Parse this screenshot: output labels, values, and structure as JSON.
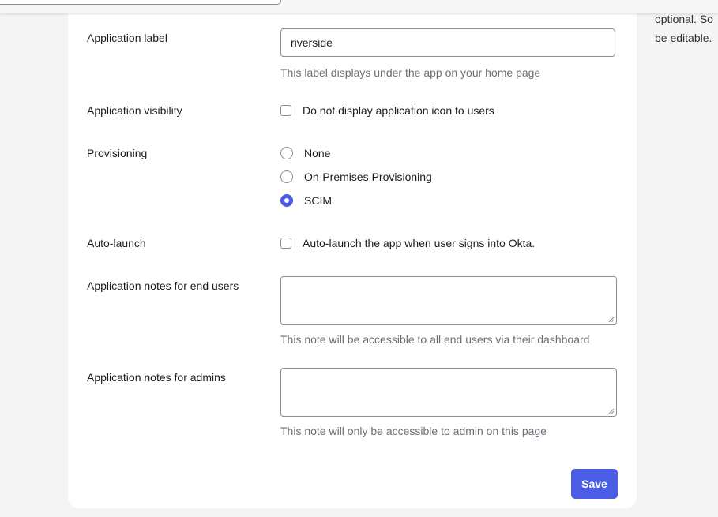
{
  "side_note": {
    "line1": "optional. So",
    "line2": "be editable."
  },
  "form": {
    "app_label": {
      "label": "Application label",
      "value": "riverside",
      "help": "This label displays under the app on your home page"
    },
    "visibility": {
      "label": "Application visibility",
      "option": "Do not display application icon to users",
      "checked": false
    },
    "provisioning": {
      "label": "Provisioning",
      "options": [
        "None",
        "On-Premises Provisioning",
        "SCIM"
      ],
      "selected": "SCIM"
    },
    "auto_launch": {
      "label": "Auto-launch",
      "option": "Auto-launch the app when user signs into Okta.",
      "checked": false
    },
    "notes_end_users": {
      "label": "Application notes for end users",
      "value": "",
      "help": "This note will be accessible to all end users via their dashboard"
    },
    "notes_admins": {
      "label": "Application notes for admins",
      "value": "",
      "help": "This note will only be accessible to admin on this page"
    },
    "save_label": "Save"
  },
  "colors": {
    "accent": "#4b5de4",
    "help_text": "#6e6e78",
    "border": "#8c8c96"
  }
}
